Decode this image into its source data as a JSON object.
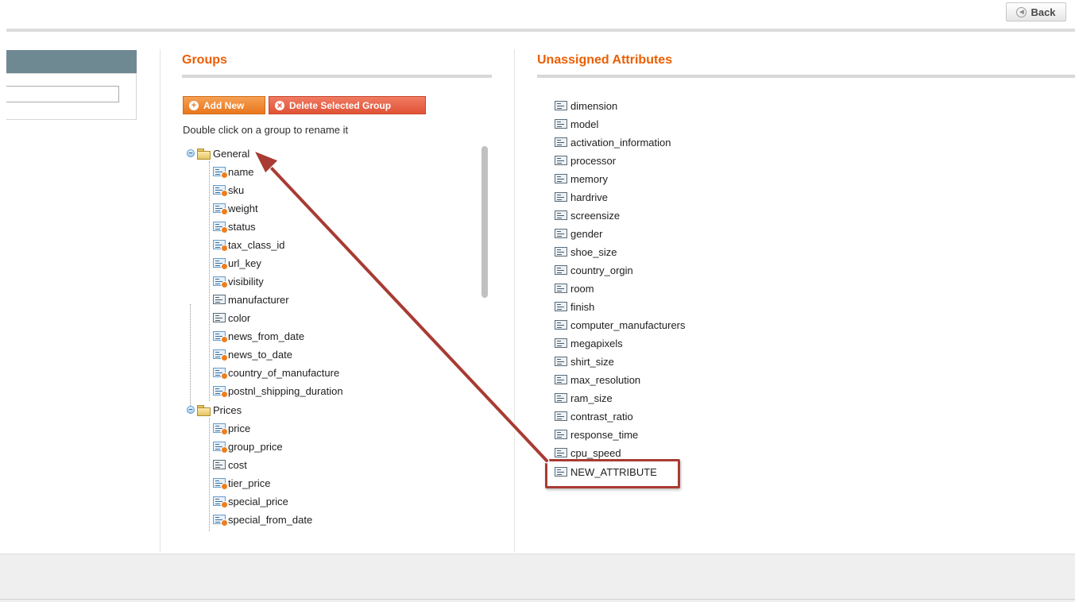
{
  "header": {
    "back_label": "Back"
  },
  "groups": {
    "title": "Groups",
    "add_new_label": "Add New",
    "delete_label": "Delete Selected Group",
    "hint": "Double click on a group to rename it",
    "general": {
      "label": "General",
      "items": [
        "name",
        "sku",
        "weight",
        "status",
        "tax_class_id",
        "url_key",
        "visibility",
        "manufacturer",
        "color",
        "news_from_date",
        "news_to_date",
        "country_of_manufacture",
        "postnl_shipping_duration"
      ]
    },
    "prices": {
      "label": "Prices",
      "items": [
        "price",
        "group_price",
        "cost",
        "tier_price",
        "special_price",
        "special_from_date"
      ]
    }
  },
  "unassigned": {
    "title": "Unassigned Attributes",
    "items": [
      "dimension",
      "model",
      "activation_information",
      "processor",
      "memory",
      "hardrive",
      "screensize",
      "gender",
      "shoe_size",
      "country_orgin",
      "room",
      "finish",
      "computer_manufacturers",
      "megapixels",
      "shirt_size",
      "max_resolution",
      "ram_size",
      "contrast_ratio",
      "response_time",
      "cpu_speed",
      "NEW_ATTRIBUTE"
    ]
  },
  "icons": {
    "back": "back-circle-icon",
    "add": "plus-circle-icon",
    "delete": "x-circle-icon",
    "collapse": "minus-circle-icon",
    "folder": "folder-icon",
    "attribute": "attribute-icon"
  },
  "colors": {
    "accent": "#eb5e00",
    "button": "#e9761c",
    "annotation": "#a83b33",
    "sidebar_header": "#6f8992"
  }
}
